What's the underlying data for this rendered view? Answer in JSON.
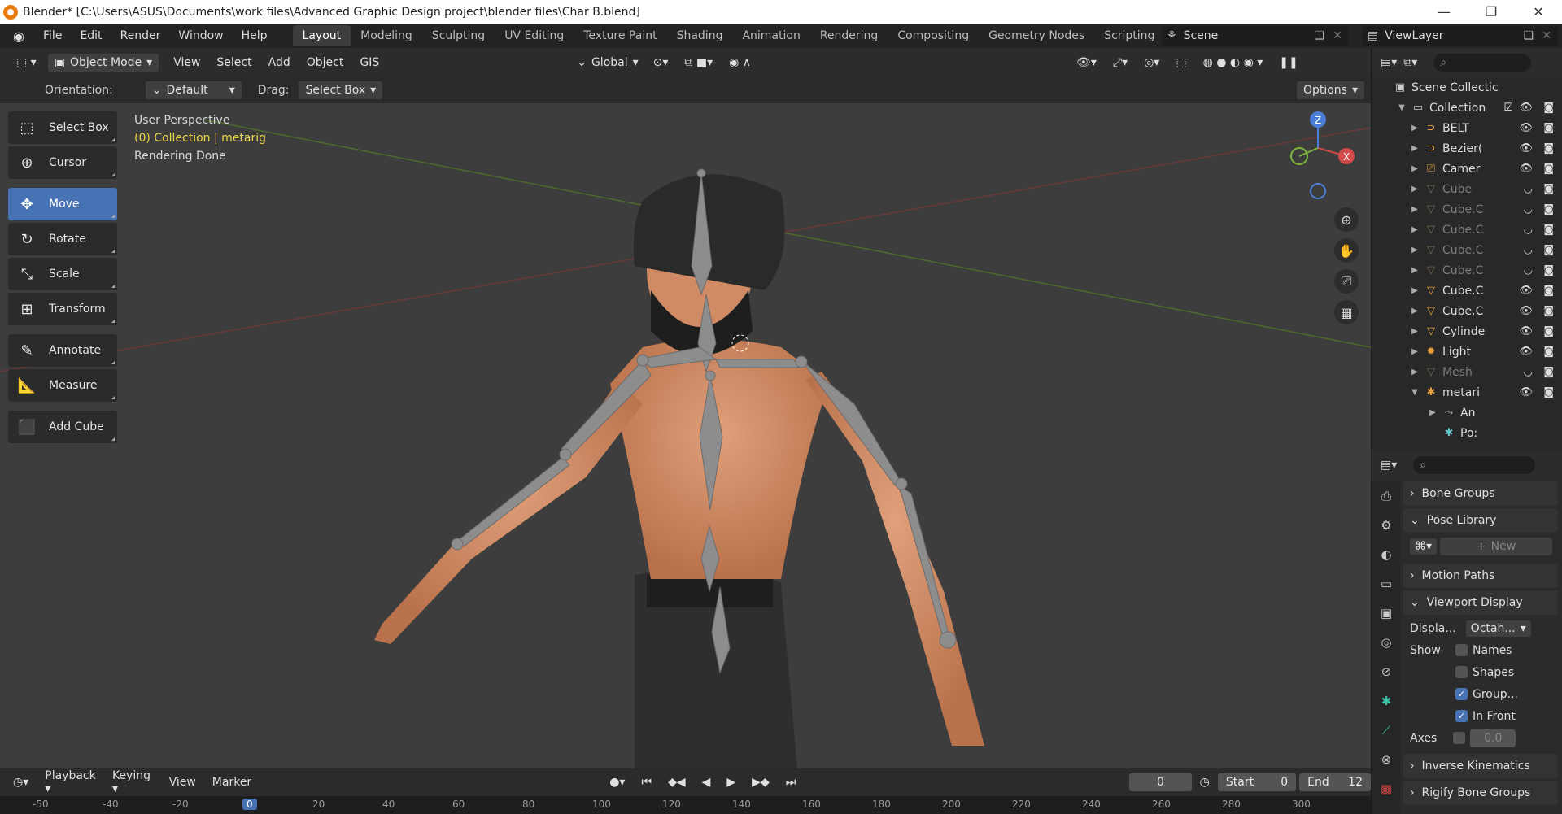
{
  "window": {
    "title": "Blender* [C:\\Users\\ASUS\\Documents\\work files\\Advanced Graphic Design project\\blender files\\Char B.blend]"
  },
  "menu": [
    "File",
    "Edit",
    "Render",
    "Window",
    "Help"
  ],
  "workspaces": [
    "Layout",
    "Modeling",
    "Sculpting",
    "UV Editing",
    "Texture Paint",
    "Shading",
    "Animation",
    "Rendering",
    "Compositing",
    "Geometry Nodes",
    "Scripting"
  ],
  "active_workspace": "Layout",
  "scene_name": "Scene",
  "view_layer": "ViewLayer",
  "header": {
    "mode": "Object Mode",
    "items": [
      "View",
      "Select",
      "Add",
      "Object",
      "GIS"
    ],
    "transform": "Global"
  },
  "header2": {
    "orientation_label": "Orientation:",
    "orientation_value": "Default",
    "drag_label": "Drag:",
    "drag_value": "Select Box",
    "options": "Options"
  },
  "tools": [
    {
      "label": "Select Box",
      "icon": "select-box-icon"
    },
    {
      "label": "Cursor",
      "icon": "cursor-icon"
    },
    {
      "label": "Move",
      "icon": "move-icon"
    },
    {
      "label": "Rotate",
      "icon": "rotate-icon"
    },
    {
      "label": "Scale",
      "icon": "scale-icon"
    },
    {
      "label": "Transform",
      "icon": "transform-icon"
    },
    {
      "label": "Annotate",
      "icon": "annotate-icon"
    },
    {
      "label": "Measure",
      "icon": "measure-icon"
    },
    {
      "label": "Add Cube",
      "icon": "add-cube-icon"
    }
  ],
  "active_tool": "Move",
  "viewport_info": {
    "line1": "User Perspective",
    "line2": "(0) Collection | metarig",
    "line3": "Rendering Done"
  },
  "gizmo": {
    "z": "Z",
    "x": "X"
  },
  "outliner": {
    "root": "Scene Collectic",
    "collection": "Collection",
    "items": [
      {
        "name": "BELT",
        "dim": false
      },
      {
        "name": "Bezier(",
        "dim": false
      },
      {
        "name": "Camer",
        "dim": false
      },
      {
        "name": "Cube",
        "dim": true
      },
      {
        "name": "Cube.C",
        "dim": true
      },
      {
        "name": "Cube.C",
        "dim": true
      },
      {
        "name": "Cube.C",
        "dim": true
      },
      {
        "name": "Cube.C",
        "dim": true
      },
      {
        "name": "Cube.C",
        "dim": false
      },
      {
        "name": "Cube.C",
        "dim": false
      },
      {
        "name": "Cylinde",
        "dim": false
      },
      {
        "name": "Light",
        "dim": false
      },
      {
        "name": "Mesh",
        "dim": true
      },
      {
        "name": "metari",
        "dim": false
      }
    ],
    "children": [
      "An",
      "Po:"
    ]
  },
  "properties": {
    "panels_top": [
      "Bone Groups",
      "Pose Library"
    ],
    "new_label": "New",
    "motion_paths": "Motion Paths",
    "viewport_display": "Viewport Display",
    "display_label": "Displa...",
    "display_value": "Octah...",
    "show_label": "Show",
    "show_items": [
      {
        "label": "Names",
        "checked": false
      },
      {
        "label": "Shapes",
        "checked": false
      },
      {
        "label": "Group...",
        "checked": true
      },
      {
        "label": "In Front",
        "checked": true
      }
    ],
    "axes_label": "Axes",
    "axes_value": "0.0",
    "ik": "Inverse Kinematics",
    "rigify": "Rigify Bone Groups"
  },
  "timeline": {
    "playback": "Playback",
    "keying": "Keying",
    "view": "View",
    "marker": "Marker",
    "current_frame": "0",
    "start_label": "Start",
    "start": "0",
    "end_label": "End",
    "end": "12",
    "ruler": [
      "-50",
      "-40",
      "-20",
      "0",
      "20",
      "40",
      "60",
      "80",
      "100",
      "120",
      "140",
      "160",
      "180",
      "200",
      "220",
      "240",
      "260",
      "280",
      "300"
    ]
  }
}
